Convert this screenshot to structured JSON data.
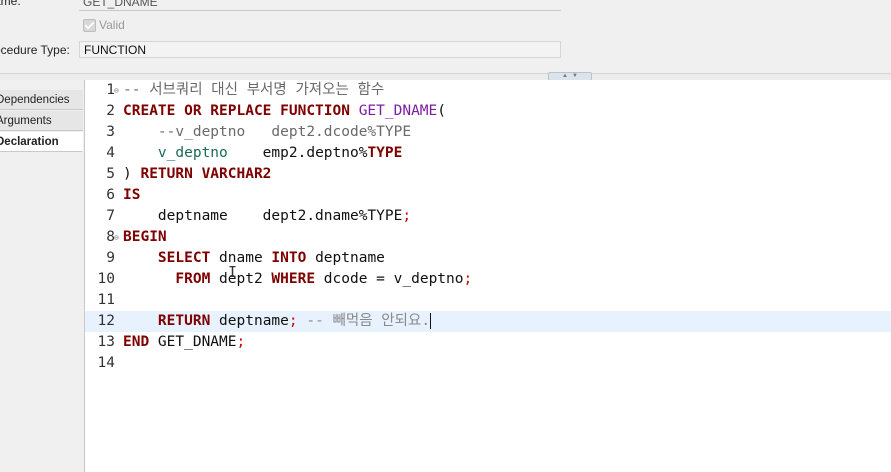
{
  "form": {
    "name_label": "ame:",
    "name_value": "GET_DNAME",
    "valid_label": "Valid",
    "type_label": "ocedure Type:",
    "type_value": "FUNCTION"
  },
  "nav": {
    "items": [
      "Dependencies",
      "Arguments",
      "Declaration"
    ],
    "selected": "Declaration"
  },
  "editor": {
    "lines": [
      {
        "n": "1",
        "fold": "⊖",
        "parts": [
          [
            "cm",
            "-- 서브쿼리 대신 부서명 가져오는 함수"
          ]
        ]
      },
      {
        "n": "2",
        "parts": [
          [
            "kw",
            "CREATE OR REPLACE FUNCTION "
          ],
          [
            "fn",
            "GET_DNAME"
          ],
          [
            "plain",
            "("
          ]
        ]
      },
      {
        "n": "3",
        "parts": [
          [
            "plain",
            "    "
          ],
          [
            "cm",
            "--v_deptno   dept2.dcode%TYPE"
          ]
        ]
      },
      {
        "n": "4",
        "parts": [
          [
            "plain",
            "    "
          ],
          [
            "vr",
            "v_deptno"
          ],
          [
            "plain",
            "    emp2.deptno%"
          ],
          [
            "kw",
            "TYPE"
          ]
        ]
      },
      {
        "n": "5",
        "parts": [
          [
            "plain",
            ") "
          ],
          [
            "kw",
            "RETURN VARCHAR2"
          ]
        ]
      },
      {
        "n": "6",
        "parts": [
          [
            "kw",
            "IS"
          ]
        ]
      },
      {
        "n": "7",
        "parts": [
          [
            "plain",
            "    deptname    dept2.dname%TYPE"
          ],
          [
            "semi",
            ";"
          ]
        ]
      },
      {
        "n": "8",
        "fold": "⊖",
        "parts": [
          [
            "kw",
            "BEGIN"
          ]
        ]
      },
      {
        "n": "9",
        "parts": [
          [
            "plain",
            "    "
          ],
          [
            "kw",
            "SELECT"
          ],
          [
            "plain",
            " dname "
          ],
          [
            "kw",
            "INTO"
          ],
          [
            "plain",
            " deptname"
          ]
        ]
      },
      {
        "n": "10",
        "parts": [
          [
            "plain",
            "      "
          ],
          [
            "kw",
            "FROM"
          ],
          [
            "plain",
            " dept2 "
          ],
          [
            "kw",
            "WHERE"
          ],
          [
            "plain",
            " dcode = v_deptno"
          ],
          [
            "semi",
            ";"
          ]
        ]
      },
      {
        "n": "11",
        "parts": []
      },
      {
        "n": "12",
        "hl": true,
        "caret": true,
        "parts": [
          [
            "plain",
            "    "
          ],
          [
            "kw",
            "RETURN"
          ],
          [
            "plain",
            " deptname"
          ],
          [
            "semi",
            ";"
          ],
          [
            "cmk",
            " -- 빼먹음 안되요."
          ]
        ]
      },
      {
        "n": "13",
        "parts": [
          [
            "kw",
            "END"
          ],
          [
            "plain",
            " GET_DNAME"
          ],
          [
            "semi",
            ";"
          ]
        ]
      },
      {
        "n": "14",
        "parts": []
      }
    ]
  }
}
